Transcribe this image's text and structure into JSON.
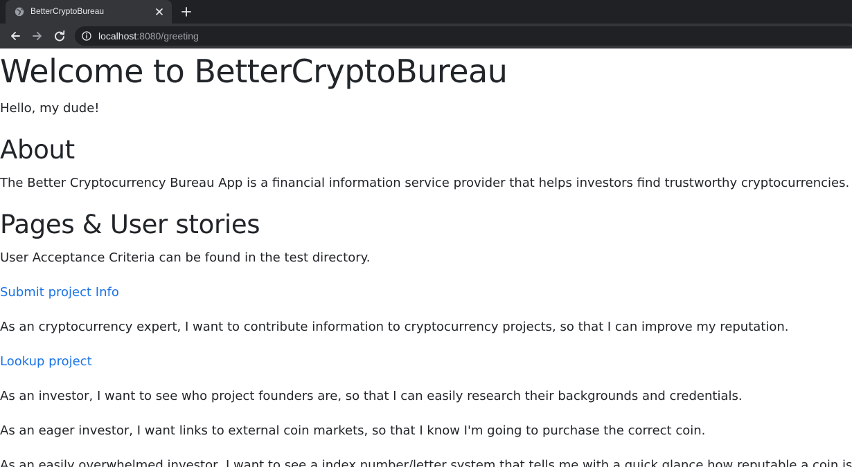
{
  "browser": {
    "tab_title": "BetterCryptoBureau",
    "url_host": "localhost",
    "url_rest": ":8080/greeting"
  },
  "page": {
    "title": "Welcome to BetterCryptoBureau",
    "greeting": "Hello, my dude!",
    "about_heading": "About",
    "about_text": "The Better Cryptocurrency Bureau App is a financial information service provider that helps investors find trustworthy cryptocurrencies.",
    "pages_heading": "Pages & User stories",
    "criteria_text": "User Acceptance Criteria can be found in the test directory.",
    "submit_link": "Submit project Info",
    "submit_story": "As an cryptocurrency expert, I want to contribute information to cryptocurrency projects, so that I can improve my reputation.",
    "lookup_link": "Lookup project",
    "lookup_story_1": "As an investor, I want to see who project founders are, so that I can easily research their backgrounds and credentials.",
    "lookup_story_2": "As an eager investor, I want links to external coin markets, so that I know I'm going to purchase the correct coin.",
    "lookup_story_3": "As an easily overwhelmed investor, I want to see a index number/letter system that tells me with a quick glance how reputable a coin is."
  },
  "colors": {
    "link": "#1a73e8",
    "text": "#212529",
    "chrome_dark": "#202124",
    "chrome_tab": "#35363a"
  },
  "icons": [
    "globe-icon",
    "close-icon",
    "plus-icon",
    "back-arrow-icon",
    "forward-arrow-icon",
    "reload-icon",
    "info-icon"
  ]
}
